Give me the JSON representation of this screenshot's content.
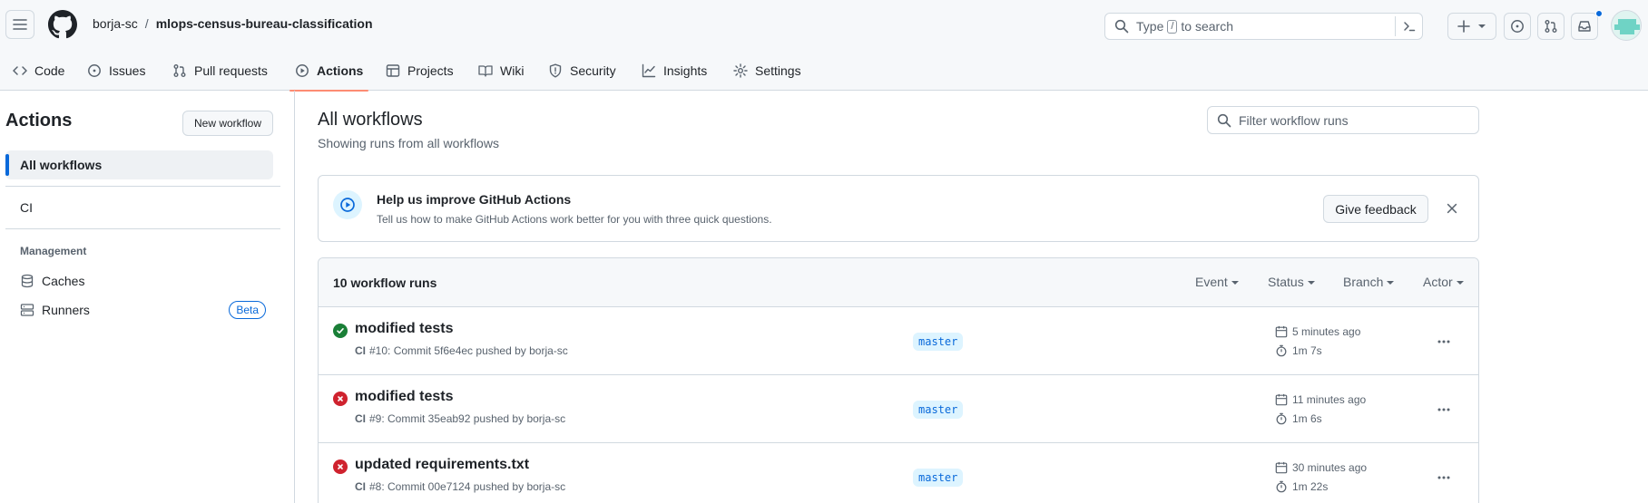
{
  "header": {
    "owner": "borja-sc",
    "separator": "/",
    "repo": "mlops-census-bureau-classification",
    "search": {
      "prefix": "Type",
      "key": "/",
      "suffix": "to search"
    }
  },
  "tabs": [
    {
      "label": "Code",
      "icon": "code-icon"
    },
    {
      "label": "Issues",
      "icon": "issue-opened-icon"
    },
    {
      "label": "Pull requests",
      "icon": "git-pull-request-icon"
    },
    {
      "label": "Actions",
      "icon": "play-icon",
      "active": true
    },
    {
      "label": "Projects",
      "icon": "table-icon"
    },
    {
      "label": "Wiki",
      "icon": "book-icon"
    },
    {
      "label": "Security",
      "icon": "shield-icon"
    },
    {
      "label": "Insights",
      "icon": "graph-icon"
    },
    {
      "label": "Settings",
      "icon": "gear-icon"
    }
  ],
  "sidebar": {
    "title": "Actions",
    "new_workflow": "New workflow",
    "items": [
      {
        "label": "All workflows",
        "active": true
      },
      {
        "label": "CI"
      }
    ],
    "management_heading": "Management",
    "management": [
      {
        "label": "Caches",
        "icon": "database-icon"
      },
      {
        "label": "Runners",
        "icon": "server-icon",
        "badge": "Beta"
      }
    ]
  },
  "main": {
    "title": "All workflows",
    "subtitle": "Showing runs from all workflows",
    "filter_placeholder": "Filter workflow runs"
  },
  "feedback": {
    "title": "Help us improve GitHub Actions",
    "description": "Tell us how to make GitHub Actions work better for you with three quick questions.",
    "button": "Give feedback"
  },
  "runs": {
    "count_label": "10 workflow runs",
    "filters": [
      "Event",
      "Status",
      "Branch",
      "Actor"
    ],
    "items": [
      {
        "status": "success",
        "title": "modified tests",
        "workflow": "CI",
        "detail": "#10: Commit 5f6e4ec pushed by borja-sc",
        "branch": "master",
        "when": "5 minutes ago",
        "duration": "1m 7s"
      },
      {
        "status": "failure",
        "title": "modified tests",
        "workflow": "CI",
        "detail": "#9: Commit 35eab92 pushed by borja-sc",
        "branch": "master",
        "when": "11 minutes ago",
        "duration": "1m 6s"
      },
      {
        "status": "failure",
        "title": "updated requirements.txt",
        "workflow": "CI",
        "detail": "#8: Commit 00e7124 pushed by borja-sc",
        "branch": "master",
        "when": "30 minutes ago",
        "duration": "1m 22s"
      }
    ]
  },
  "colors": {
    "success": "#1a7f37",
    "failure": "#cf222e",
    "accent": "#0969da",
    "tab_underline": "#fd8c73"
  }
}
